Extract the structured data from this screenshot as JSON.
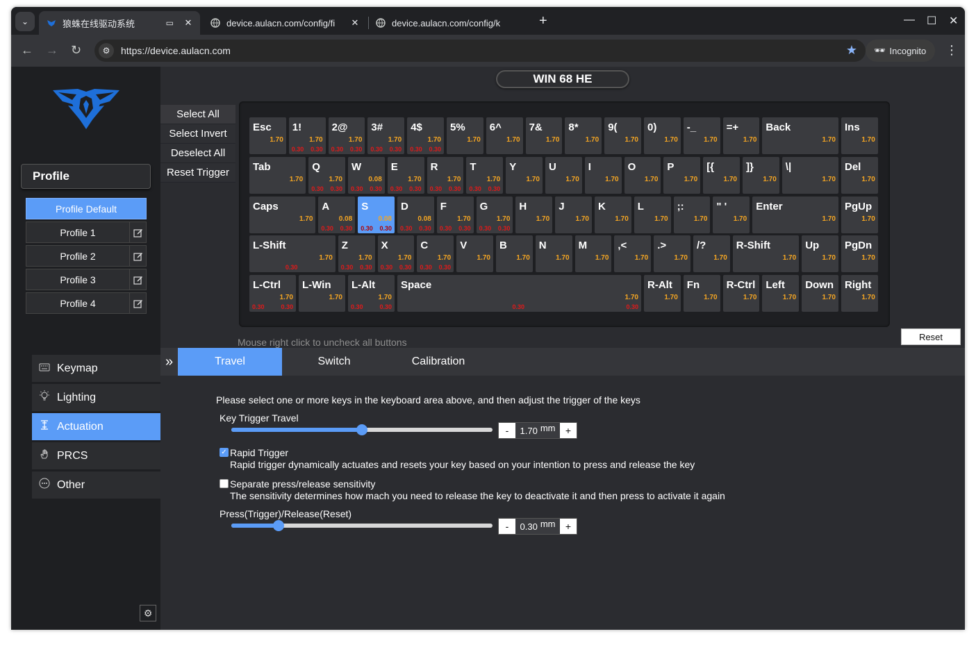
{
  "browser": {
    "tabs": [
      {
        "title": "狼蛛在线驱动系统",
        "active": true
      },
      {
        "title": "device.aulacn.com/config/fi",
        "active": false
      },
      {
        "title": "device.aulacn.com/config/k",
        "active": false
      }
    ],
    "url": "https://device.aulacn.com",
    "incognito_label": "Incognito"
  },
  "sidebar": {
    "profile_header": "Profile",
    "profiles": [
      {
        "label": "Profile Default",
        "active": true
      },
      {
        "label": "Profile 1"
      },
      {
        "label": "Profile 2"
      },
      {
        "label": "Profile 3"
      },
      {
        "label": "Profile 4"
      }
    ],
    "menu": [
      {
        "label": "Keymap",
        "icon": "keyboard-icon"
      },
      {
        "label": "Lighting",
        "icon": "bulb-icon"
      },
      {
        "label": "Actuation",
        "icon": "actuation-icon",
        "active": true
      },
      {
        "label": "PRCS",
        "icon": "hand-icon"
      },
      {
        "label": "Other",
        "icon": "dots-circle-icon"
      }
    ]
  },
  "keyboard": {
    "model": "WIN 68 HE",
    "select_buttons": [
      "Select All",
      "Select Invert",
      "Deselect All",
      "Reset Trigger"
    ],
    "hint": "Mouse right click to uncheck all buttons",
    "reset_label": "Reset",
    "rows": [
      [
        {
          "l": "Esc",
          "t": "1.70"
        },
        {
          "l": "1!",
          "t": "1.70",
          "r": [
            "0.30",
            "0.30"
          ]
        },
        {
          "l": "2@",
          "t": "1.70",
          "r": [
            "0.30",
            "0.30"
          ]
        },
        {
          "l": "3#",
          "t": "1.70",
          "r": [
            "0.30",
            "0.30"
          ]
        },
        {
          "l": "4$",
          "t": "1.70",
          "r": [
            "0.30",
            "0.30"
          ]
        },
        {
          "l": "5%",
          "t": "1.70"
        },
        {
          "l": "6^",
          "t": "1.70"
        },
        {
          "l": "7&",
          "t": "1.70"
        },
        {
          "l": "8*",
          "t": "1.70"
        },
        {
          "l": "9(",
          "t": "1.70"
        },
        {
          "l": "0)",
          "t": "1.70"
        },
        {
          "l": "-_",
          "t": "1.70"
        },
        {
          "l": "=+",
          "t": "1.70"
        },
        {
          "l": "Back",
          "t": "1.70"
        },
        {
          "l": "Ins",
          "t": "1.70"
        }
      ],
      [
        {
          "l": "Tab",
          "t": "1.70"
        },
        {
          "l": "Q",
          "t": "1.70",
          "r": [
            "0.30",
            "0.30"
          ]
        },
        {
          "l": "W",
          "t": "0.08",
          "r": [
            "0.30",
            "0.30"
          ]
        },
        {
          "l": "E",
          "t": "1.70",
          "r": [
            "0.30",
            "0.30"
          ]
        },
        {
          "l": "R",
          "t": "1.70",
          "r": [
            "0.30",
            "0.30"
          ]
        },
        {
          "l": "T",
          "t": "1.70",
          "r": [
            "0.30",
            "0.30"
          ]
        },
        {
          "l": "Y",
          "t": "1.70"
        },
        {
          "l": "U",
          "t": "1.70"
        },
        {
          "l": "I",
          "t": "1.70"
        },
        {
          "l": "O",
          "t": "1.70"
        },
        {
          "l": "P",
          "t": "1.70"
        },
        {
          "l": "[{",
          "t": "1.70"
        },
        {
          "l": "]}",
          "t": "1.70"
        },
        {
          "l": "\\|",
          "t": "1.70"
        },
        {
          "l": "Del",
          "t": "1.70"
        }
      ],
      [
        {
          "l": "Caps",
          "t": "1.70"
        },
        {
          "l": "A",
          "t": "0.08",
          "r": [
            "0.30",
            "0.30"
          ]
        },
        {
          "l": "S",
          "t": "0.08",
          "r": [
            "0.30",
            "0.30"
          ],
          "sel": true
        },
        {
          "l": "D",
          "t": "0.08",
          "r": [
            "0.30",
            "0.30"
          ]
        },
        {
          "l": "F",
          "t": "1.70",
          "r": [
            "0.30",
            "0.30"
          ]
        },
        {
          "l": "G",
          "t": "1.70",
          "r": [
            "0.30",
            "0.30"
          ]
        },
        {
          "l": "H",
          "t": "1.70"
        },
        {
          "l": "J",
          "t": "1.70"
        },
        {
          "l": "K",
          "t": "1.70"
        },
        {
          "l": "L",
          "t": "1.70"
        },
        {
          "l": ";:",
          "t": "1.70"
        },
        {
          "l": "\" '",
          "t": "1.70"
        },
        {
          "l": "Enter",
          "t": "1.70"
        },
        {
          "l": "PgUp",
          "t": "1.70"
        }
      ],
      [
        {
          "l": "L-Shift",
          "t": "1.70",
          "r": [
            "0.30",
            ""
          ]
        },
        {
          "l": "Z",
          "t": "1.70",
          "r": [
            "0.30",
            "0.30"
          ]
        },
        {
          "l": "X",
          "t": "1.70",
          "r": [
            "0.30",
            "0.30"
          ]
        },
        {
          "l": "C",
          "t": "1.70",
          "r": [
            "0.30",
            "0.30"
          ]
        },
        {
          "l": "V",
          "t": "1.70"
        },
        {
          "l": "B",
          "t": "1.70"
        },
        {
          "l": "N",
          "t": "1.70"
        },
        {
          "l": "M",
          "t": "1.70"
        },
        {
          "l": ",<",
          "t": "1.70"
        },
        {
          "l": ".>",
          "t": "1.70"
        },
        {
          "l": "/?",
          "t": "1.70"
        },
        {
          "l": "R-Shift",
          "t": "1.70"
        },
        {
          "l": "Up",
          "t": "1.70"
        },
        {
          "l": "PgDn",
          "t": "1.70"
        }
      ],
      [
        {
          "l": "L-Ctrl",
          "t": "1.70",
          "r": [
            "0.30",
            "0.30"
          ]
        },
        {
          "l": "L-Win",
          "t": "1.70"
        },
        {
          "l": "L-Alt",
          "t": "1.70",
          "r": [
            "0.30",
            "0.30"
          ]
        },
        {
          "l": "Space",
          "t": "1.70",
          "r": [
            "0.30",
            "0.30"
          ]
        },
        {
          "l": "R-Alt",
          "t": "1.70"
        },
        {
          "l": "Fn",
          "t": "1.70"
        },
        {
          "l": "R-Ctrl",
          "t": "1.70"
        },
        {
          "l": "Left",
          "t": "1.70"
        },
        {
          "l": "Down",
          "t": "1.70"
        },
        {
          "l": "Right",
          "t": "1.70"
        }
      ]
    ]
  },
  "content_tabs": [
    {
      "label": "Travel",
      "active": true
    },
    {
      "label": "Switch"
    },
    {
      "label": "Calibration"
    }
  ],
  "travel": {
    "instruction": "Please select one or more keys in the keyboard area above, and then adjust the trigger of the keys",
    "key_trigger_label": "Key Trigger Travel",
    "key_trigger_value": "1.70",
    "key_trigger_fraction": 0.5,
    "unit": "mm",
    "minus": "-",
    "plus": "+",
    "rapid_trigger_label": "Rapid Trigger",
    "rapid_trigger_checked": true,
    "rapid_trigger_desc": "Rapid trigger dynamically actuates and resets your key based on your intention to press and release the key",
    "separate_label": "Separate press/release sensitivity",
    "separate_checked": false,
    "separate_desc": "The sensitivity determines how mach you need to release the key to deactivate it and then press to activate it again",
    "press_release_label": "Press(Trigger)/Release(Reset)",
    "press_release_value": "0.30",
    "press_release_fraction": 0.18
  }
}
